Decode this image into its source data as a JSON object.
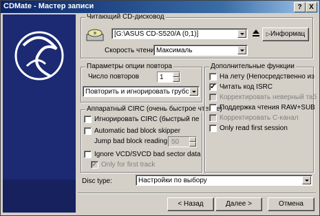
{
  "window": {
    "title": "CDMate - Мастер записи",
    "help_btn": "?",
    "close_btn": "X"
  },
  "reader": {
    "group_label": "Читающий CD-дисковод",
    "drive_value": "[G:\\ASUS CD-S520/A (0,1)]",
    "info_button": "Информац",
    "speed_label": "Скорость чтения",
    "speed_value": "Максималь"
  },
  "retry": {
    "group_label": "Параметры опции повтора",
    "count_label": "Число повторов",
    "count_value": "1",
    "mode_value": "Повторить и игнорировать грубое"
  },
  "hw_cirс": {
    "group_label": "Аппаратный CIRC (очень быстрое чтение)",
    "ignore_label": "Игнорировать CIRC (быстрый пе",
    "auto_skip_label": "Automatic bad block skipper",
    "jump_label": "Jump bad block reading",
    "jump_value": "50",
    "ignore_vcd_label": "Ignore VCD/SVCD bad sector data",
    "only_first_label": "Only for first track"
  },
  "extra": {
    "group_label": "Дополнительные функции",
    "items": [
      {
        "label": "На лету (Непосредственно из",
        "checked": false
      },
      {
        "label": "Читать код ISRC",
        "checked": true
      },
      {
        "label": "Корректировать неверный таб",
        "checked": false,
        "disabled": true
      },
      {
        "label": "Поддержка чтения RAW+SUB",
        "checked": false
      },
      {
        "label": "Корректировать С-канал",
        "checked": false,
        "disabled": true
      },
      {
        "label": "Only read first session",
        "checked": false
      }
    ]
  },
  "disc_type": {
    "label": "Disc type:",
    "value": "Настройки по выбору"
  },
  "buttons": {
    "back": "< Назад",
    "next": "Далее >",
    "cancel": "Отмена"
  },
  "colors": {
    "title_start": "#0a246a",
    "side_panel": "#1c2a73"
  }
}
